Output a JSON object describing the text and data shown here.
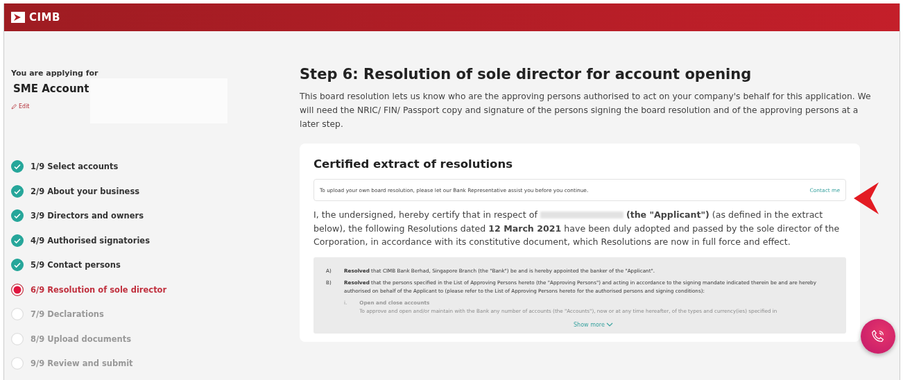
{
  "header": {
    "logo_text": "CIMB"
  },
  "sidebar": {
    "applying_label": "You are applying for",
    "product": "SME Account",
    "edit_link": "Edit",
    "steps": [
      {
        "label": "1/9 Select accounts",
        "completed": true,
        "selected": false
      },
      {
        "label": "2/9 About your business",
        "completed": true,
        "selected": false
      },
      {
        "label": "3/9 Directors and owners",
        "completed": true,
        "selected": false
      },
      {
        "label": "4/9 Authorised signatories",
        "completed": true,
        "selected": false
      },
      {
        "label": "5/9 Contact persons",
        "completed": true,
        "selected": false
      },
      {
        "label": "6/9 Resolution of sole director",
        "completed": false,
        "selected": true
      },
      {
        "label": "7/9 Declarations",
        "completed": false,
        "selected": false
      },
      {
        "label": "8/9 Upload documents",
        "completed": false,
        "selected": false
      },
      {
        "label": "9/9 Review and submit",
        "completed": false,
        "selected": false
      }
    ]
  },
  "main": {
    "title": "Step 6: Resolution of sole director for account opening",
    "intro": "This board resolution lets us know who are the approving persons authorised to act on your company's behalf for this application. We will need the NRIC/ FIN/ Passport copy and signature of the persons signing the board resolution and of the approving persons at a later step.",
    "card": {
      "title": "Certified extract of resolutions",
      "notice": "To upload your own board resolution, please let our Bank Representative assist you before you continue.",
      "contact_link": "Contact me",
      "certify_before": "I, the undersigned, hereby certify that in respect of",
      "certify_line1_after": "**(the \"Applicant\")** (as defined in the extract",
      "certify_rest": "below), the following Resolutions dated **12 March 2021** have been duly adopted and passed by the sole director of the Corporation, in accordance with its constitutive document, which Resolutions are now in full force and effect.",
      "resolutions": [
        {
          "marker": "A)",
          "text": "**Resolved** that CIMB Bank Berhad, Singapore Branch (the \"Bank\") be and is hereby appointed the banker of the \"Applicant\"."
        },
        {
          "marker": "B)",
          "text": "**Resolved** that the persons specified in the List of Approving Persons hereto (the \"Approving Persons\") and acting in accordance to the signing mandate indicated therein be and are hereby authorised on behalf of the Applicant to (please refer to the List of Approving Persons hereto for the authorised persons and signing conditions):"
        }
      ],
      "sub_item": {
        "marker": "i.",
        "title": "Open and close accounts",
        "text": "To approve and open and/or maintain with the Bank any number of accounts (the \"Accounts\"), now or at any time hereafter, of the types and currency(ies) specified in"
      },
      "show_more": "Show more"
    }
  }
}
